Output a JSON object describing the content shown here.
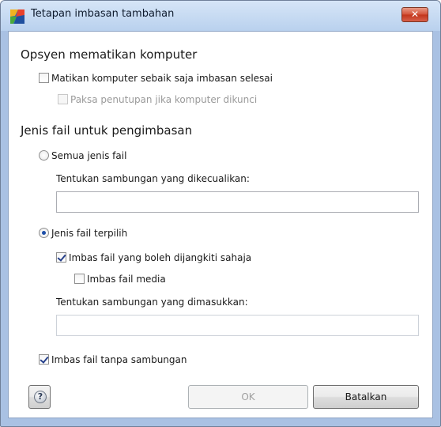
{
  "window": {
    "title": "Tetapan imbasan tambahan",
    "close_icon": "close-icon",
    "app_icon": "avg-logo-icon"
  },
  "shutdown": {
    "heading": "Opsyen mematikan komputer",
    "shutdown_after_scan": {
      "label": "Matikan komputer sebaik saja imbasan selesai",
      "checked": false
    },
    "force_if_locked": {
      "label": "Paksa penutupan jika komputer dikunci",
      "checked": false,
      "disabled": true
    }
  },
  "file_types": {
    "heading": "Jenis fail untuk pengimbasan",
    "all_types": {
      "label": "Semua jenis fail",
      "selected": false
    },
    "excluded_ext_label": "Tentukan sambungan yang dikecualikan:",
    "excluded_ext_value": "",
    "selected_types": {
      "label": "Jenis fail terpilih",
      "selected": true
    },
    "infectable_only": {
      "label": "Imbas fail yang boleh dijangkiti sahaja",
      "checked": true
    },
    "media_files": {
      "label": "Imbas fail media",
      "checked": false
    },
    "included_ext_label": "Tentukan sambungan yang dimasukkan:",
    "included_ext_value": "",
    "no_extension": {
      "label": "Imbas fail tanpa sambungan",
      "checked": true
    }
  },
  "buttons": {
    "help_icon": "help-icon",
    "help_glyph": "?",
    "ok": "OK",
    "cancel": "Batalkan"
  }
}
